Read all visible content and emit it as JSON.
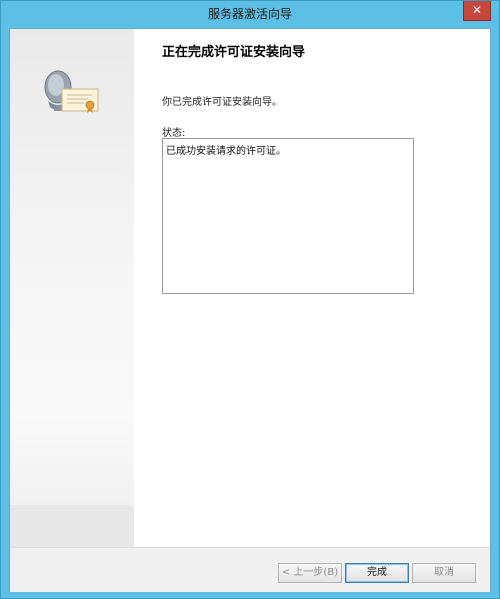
{
  "window": {
    "title": "服务器激活向导",
    "close_glyph": "✕"
  },
  "main": {
    "heading": "正在完成许可证安装向导",
    "description": "你已完成许可证安装向导。",
    "status_label": "状态:",
    "status_text": "已成功安装请求的许可证。"
  },
  "footer": {
    "back_label": "< 上一步(B)",
    "finish_label": "完成",
    "cancel_label": "取消"
  },
  "icons": {
    "wizard": "server-license-certificate-icon"
  },
  "colors": {
    "titlebar": "#5cbfe5",
    "close_button": "#c7463d",
    "default_button_border": "#3c7fb1"
  }
}
